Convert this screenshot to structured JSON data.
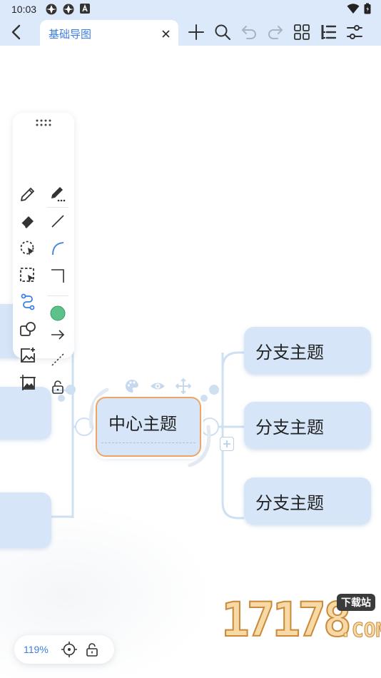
{
  "status_bar": {
    "time": "10:03"
  },
  "toolbar": {
    "tab_title": "基础导图"
  },
  "canvas": {
    "central_topic": "中心主题",
    "branches": [
      "分支主题",
      "分支主题",
      "分支主题"
    ]
  },
  "zoom": {
    "level": "119%"
  },
  "watermark": {
    "number": "17178",
    "tag": "下载站",
    "suffix": ".COM"
  },
  "colors": {
    "accent": "#3d7fe0",
    "node_fill": "#d6e6f8",
    "selected_border": "#f0a363",
    "palette_green": "#5cc28a",
    "header_bg": "#dce9fb"
  }
}
